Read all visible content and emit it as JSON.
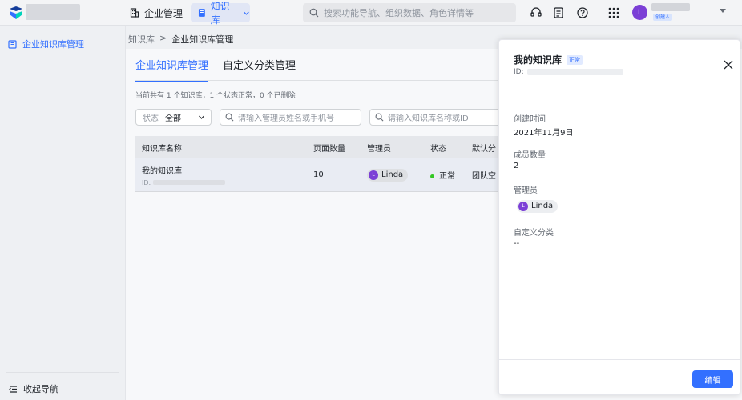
{
  "topbar": {
    "nav_enterprise": "企业管理",
    "nav_kb": "知识库",
    "search_placeholder": "搜索功能导航、组织数据、角色详情等",
    "avatar_letter": "L",
    "creator_badge": "创建人"
  },
  "sidebar": {
    "item_label": "企业知识库管理",
    "collapse_label": "收起导航"
  },
  "breadcrumb": {
    "root": "知识库",
    "sep": ">",
    "current": "企业知识库管理"
  },
  "tabs": [
    {
      "label": "企业知识库管理"
    },
    {
      "label": "自定义分类管理"
    }
  ],
  "summary": "当前共有 1 个知识库，1 个状态正常，0 个已删除",
  "filters": {
    "status_label": "状态",
    "status_value": "全部",
    "admin_placeholder": "请输入管理员姓名或手机号",
    "name_placeholder": "请输入知识库名称或ID"
  },
  "table": {
    "headers": [
      "知识库名称",
      "页面数量",
      "管理员",
      "状态",
      "默认分"
    ],
    "rows": [
      {
        "name": "我的知识库",
        "id_label": "ID:",
        "pages": "10",
        "admin_letter": "L",
        "admin": "Linda",
        "status": "正常",
        "default": "团队空"
      }
    ]
  },
  "drawer": {
    "title": "我的知识库",
    "badge": "正常",
    "id_label": "ID:",
    "created_label": "创建时间",
    "created_value": "2021年11月9日",
    "members_label": "成员数量",
    "members_value": "2",
    "admin_label": "管理员",
    "admin_letter": "L",
    "admin_name": "Linda",
    "category_label": "自定义分类",
    "category_value": "--",
    "edit_label": "编辑"
  },
  "colors": {
    "accent": "#3370ff",
    "avatar": "#7b3fd6",
    "status_ok": "#34c724"
  }
}
